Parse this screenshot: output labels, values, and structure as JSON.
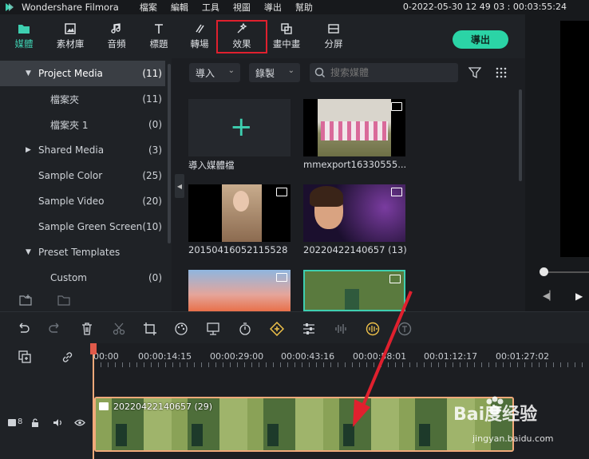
{
  "titlebar": {
    "app_name": "Wondershare Filmora",
    "menu": [
      "檔案",
      "編輯",
      "工具",
      "視圖",
      "導出",
      "幫助"
    ],
    "project_title": "0-2022-05-30 12 49 03 : 00:03:55:24"
  },
  "toolbar": {
    "tabs": [
      {
        "label": "媒體",
        "icon": "folder-icon"
      },
      {
        "label": "素材庫",
        "icon": "image-library-icon"
      },
      {
        "label": "音頻",
        "icon": "music-note-icon"
      },
      {
        "label": "標題",
        "icon": "text-t-icon"
      },
      {
        "label": "轉場",
        "icon": "transition-icon"
      },
      {
        "label": "效果",
        "icon": "effects-sparkle-icon"
      },
      {
        "label": "畫中畫",
        "icon": "pip-overlay-icon"
      },
      {
        "label": "分屏",
        "icon": "split-screen-icon"
      }
    ],
    "active": "媒體",
    "export_label": "導出"
  },
  "tree": [
    {
      "label": "Project Media",
      "count": "(11)"
    },
    {
      "label": "檔案夾",
      "count": "(11)"
    },
    {
      "label": "檔案夾 1",
      "count": "(0)"
    },
    {
      "label": "Shared Media",
      "count": "(3)"
    },
    {
      "label": "Sample Color",
      "count": "(25)"
    },
    {
      "label": "Sample Video",
      "count": "(20)"
    },
    {
      "label": "Sample Green Screen",
      "count": "(10)"
    },
    {
      "label": "Preset Templates",
      "count": ""
    },
    {
      "label": "Custom",
      "count": "(0)"
    }
  ],
  "media": {
    "import_label": "導入",
    "record_label": "錄製",
    "search_placeholder": "搜索媒體",
    "items": [
      {
        "caption": "導入媒體檔"
      },
      {
        "caption": "mmexport16330555..."
      },
      {
        "caption": "20150416052115528"
      },
      {
        "caption": "20220422140657 (13)"
      }
    ]
  },
  "timeline": {
    "ruler": [
      "00:00",
      "00:00:14:15",
      "00:00:29:00",
      "00:00:43:16",
      "00:00:58:01",
      "00:01:12:17",
      "00:01:27:02"
    ],
    "clip_label": "20220422140657 (29)",
    "track_number": "8"
  },
  "watermark": {
    "text": "Bai度经验",
    "url": "jingyan.baidu.com"
  },
  "colors": {
    "accent": "#2bd4a6",
    "highlight": "#e0202e",
    "clip_border": "#f0a97a"
  }
}
